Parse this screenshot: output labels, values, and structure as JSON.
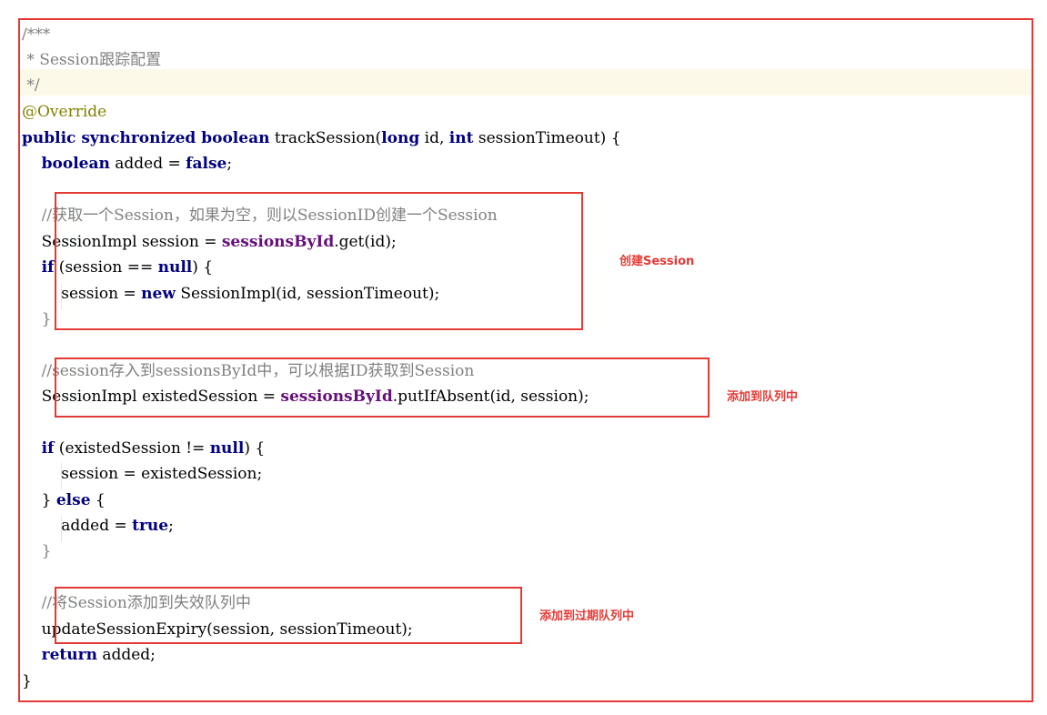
{
  "code": {
    "l1": "/***",
    "l2": " * Session跟踪配置",
    "l3": " */",
    "l4": "@Override",
    "l5": {
      "kw1": "public synchronized boolean",
      "t1": " trackSession(",
      "kw2": "long",
      "t2": " id, ",
      "kw3": "int",
      "t3": " sessionTimeout) {"
    },
    "l6": {
      "indent": "    ",
      "kw1": "boolean",
      "t1": " added = ",
      "kw2": "false",
      "t2": ";"
    },
    "l8": "    //获取一个Session，如果为空，则以SessionID创建一个Session",
    "l9": {
      "t1": "    SessionImpl session = ",
      "fld": "sessionsById",
      "t2": ".get(id);"
    },
    "l10": {
      "indent": "    ",
      "kw1": "if",
      "t1": " (session == ",
      "kw2": "null",
      "t2": ") {"
    },
    "l11": {
      "t1": "        session = ",
      "kw": "new",
      "t2": " SessionImpl(id, sessionTimeout);"
    },
    "l12": "    }",
    "l14": "    //session存入到sessionsById中，可以根据ID获取到Session",
    "l15": {
      "t1": "    SessionImpl existedSession = ",
      "fld": "sessionsById",
      "t2": ".putIfAbsent(id, session);"
    },
    "l17": {
      "indent": "    ",
      "kw1": "if",
      "t1": " (existedSession != ",
      "kw2": "null",
      "t2": ") {"
    },
    "l18": "        session = existedSession;",
    "l19": {
      "t1": "    } ",
      "kw": "else",
      "t2": " {"
    },
    "l20": {
      "t1": "        added = ",
      "kw": "true",
      "t2": ";"
    },
    "l21": "    }",
    "l23": "    //将Session添加到失效队列中",
    "l24": "    updateSessionExpiry(session, sessionTimeout);",
    "l25": {
      "indent": "    ",
      "kw": "return",
      "t1": " added;"
    },
    "l26": "}"
  },
  "annotations": {
    "create_session": "创建Session",
    "add_to_queue": "添加到队列中",
    "add_to_expiry_queue": "添加到过期队列中"
  },
  "colors": {
    "highlight_border": "#e53935",
    "keyword": "#000080",
    "comment": "#808080",
    "annotation": "#808000",
    "field": "#660e7a",
    "current_line": "#fdf9e8"
  }
}
